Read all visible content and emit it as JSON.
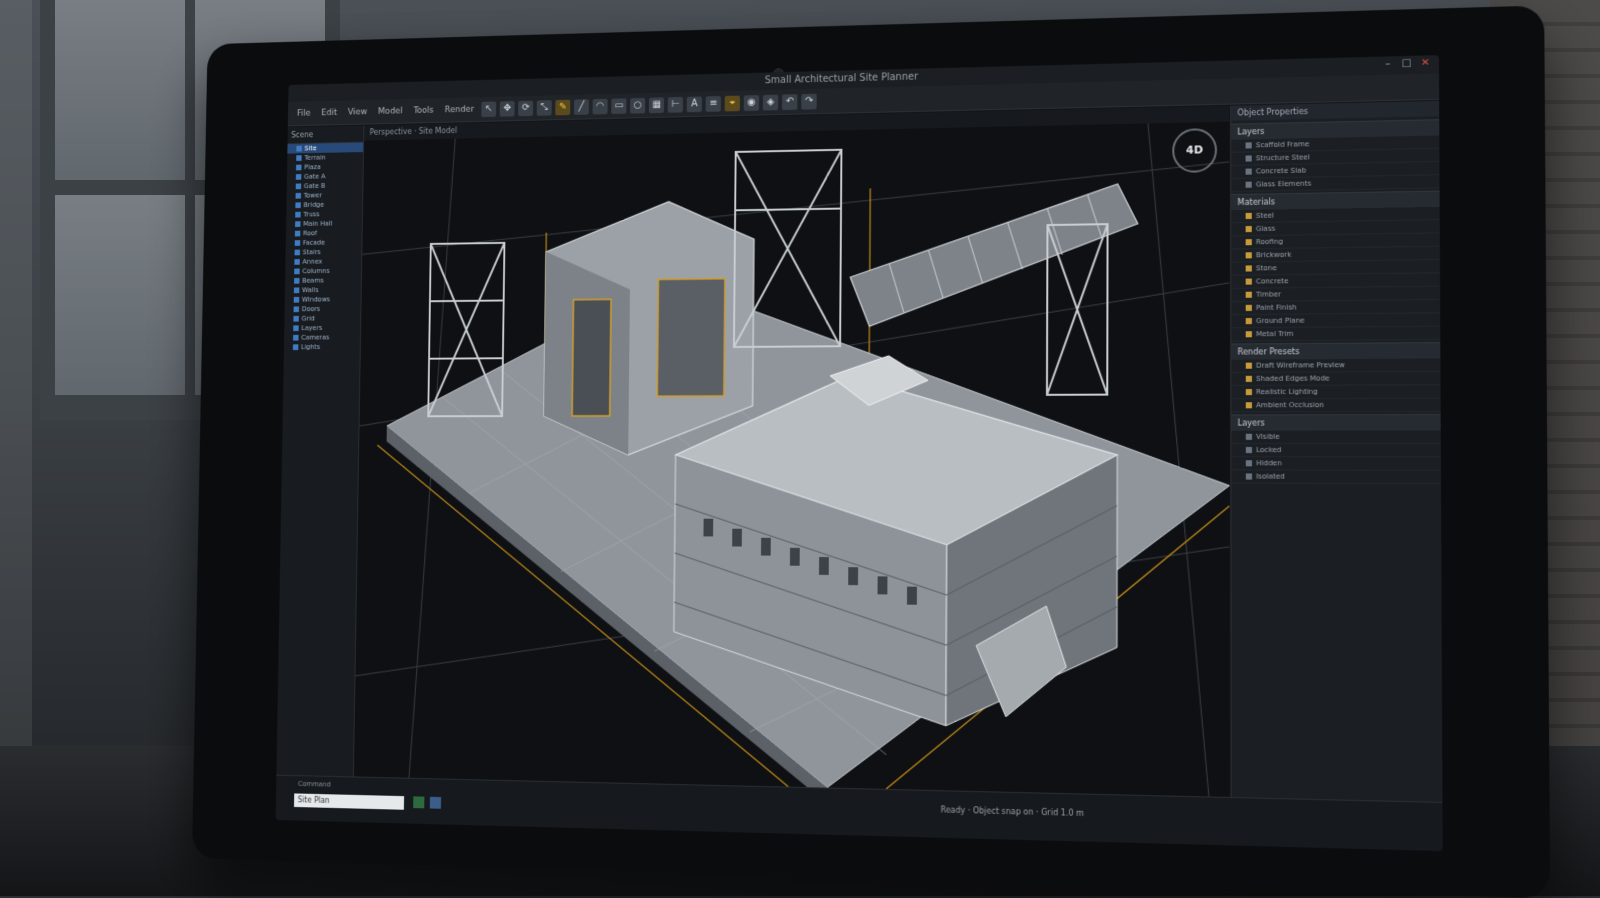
{
  "window": {
    "title": "Small Architectural Site Planner"
  },
  "menus": [
    "File",
    "Edit",
    "View",
    "Model",
    "Tools",
    "Render"
  ],
  "viewport": {
    "tab_label": "Perspective  ·  Site Model",
    "gizmo_label": "4D"
  },
  "left_panel": {
    "header": "Scene",
    "items": [
      "Site",
      "Terrain",
      "Plaza",
      "Gate A",
      "Gate B",
      "Tower",
      "Bridge",
      "Truss",
      "Main Hall",
      "Roof",
      "Facade",
      "Stairs",
      "Annex",
      "Columns",
      "Beams",
      "Walls",
      "Windows",
      "Doors",
      "Grid",
      "Layers",
      "Cameras",
      "Lights"
    ]
  },
  "right_panel": {
    "title": "Object Properties",
    "section1": {
      "label": "Layers",
      "rows": [
        "Scaffold Frame",
        "Structure Steel",
        "Concrete Slab",
        "Glass Elements"
      ]
    },
    "section2": {
      "label": "Materials",
      "rows": [
        "Steel",
        "Glass",
        "Roofing",
        "Brickwork",
        "Stone",
        "Concrete",
        "Timber",
        "Paint Finish",
        "Ground Plane",
        "Metal Trim"
      ]
    },
    "section3": {
      "label": "Render Presets",
      "rows": [
        "Draft Wireframe Preview",
        "Shaded Edges Mode",
        "Realistic Lighting",
        "Ambient Occlusion"
      ]
    },
    "section4": {
      "label": "Layers",
      "rows": [
        "Visible",
        "Locked",
        "Hidden",
        "Isolated"
      ]
    }
  },
  "status_bar": {
    "command_label": "Command",
    "command_value": "Site Plan",
    "message": "Ready  ·  Object snap on  ·  Grid 1.0 m"
  },
  "colors": {
    "accent": "#e0a020",
    "selection": "#274a7a"
  }
}
